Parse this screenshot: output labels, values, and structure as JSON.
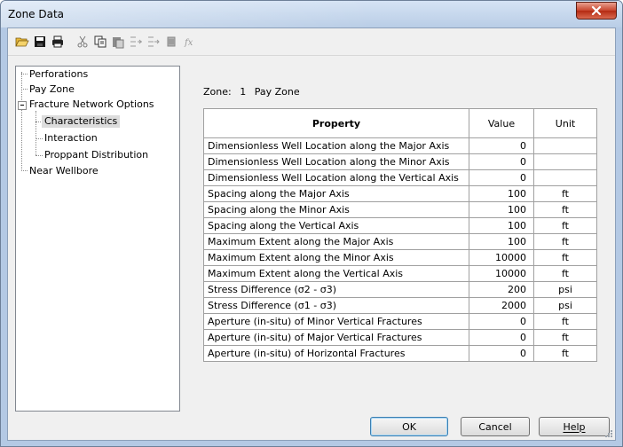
{
  "window": {
    "title": "Zone Data",
    "close_icon": "close-icon"
  },
  "toolbar": {
    "icons": [
      "open-icon",
      "save-icon",
      "print-icon",
      "cut-icon",
      "copy-icon",
      "paste-icon",
      "insert-row-icon",
      "append-row-icon",
      "delete-row-icon",
      "function-icon"
    ]
  },
  "tree": {
    "items": [
      {
        "label": "Perforations"
      },
      {
        "label": "Pay Zone"
      },
      {
        "label": "Fracture Network Options"
      },
      {
        "label": "Characteristics"
      },
      {
        "label": "Interaction"
      },
      {
        "label": "Proppant Distribution"
      },
      {
        "label": "Near Wellbore"
      }
    ],
    "selected": "Characteristics"
  },
  "zone": {
    "label": "Zone:",
    "number": "1",
    "name": "Pay Zone"
  },
  "table": {
    "headers": {
      "property": "Property",
      "value": "Value",
      "unit": "Unit"
    },
    "rows": [
      {
        "property": "Dimensionless Well Location along the Major Axis",
        "value": "0",
        "unit": ""
      },
      {
        "property": "Dimensionless Well Location along the Minor Axis",
        "value": "0",
        "unit": ""
      },
      {
        "property": "Dimensionless Well Location along the Vertical Axis",
        "value": "0",
        "unit": ""
      },
      {
        "property": "Spacing along the Major Axis",
        "value": "100",
        "unit": "ft"
      },
      {
        "property": "Spacing along the Minor Axis",
        "value": "100",
        "unit": "ft"
      },
      {
        "property": "Spacing along the Vertical Axis",
        "value": "100",
        "unit": "ft"
      },
      {
        "property": "Maximum Extent along the Major Axis",
        "value": "100",
        "unit": "ft"
      },
      {
        "property": "Maximum Extent along the Minor Axis",
        "value": "10000",
        "unit": "ft"
      },
      {
        "property": "Maximum Extent along the Vertical Axis",
        "value": "10000",
        "unit": "ft"
      },
      {
        "property": "Stress Difference (σ2 - σ3)",
        "value": "200",
        "unit": "psi"
      },
      {
        "property": "Stress Difference (σ1 - σ3)",
        "value": "2000",
        "unit": "psi"
      },
      {
        "property": "Aperture (in-situ) of Minor Vertical Fractures",
        "value": "0",
        "unit": "ft"
      },
      {
        "property": "Aperture (in-situ) of Major Vertical Fractures",
        "value": "0",
        "unit": "ft"
      },
      {
        "property": "Aperture (in-situ) of Horizontal Fractures",
        "value": "0",
        "unit": "ft"
      }
    ]
  },
  "buttons": {
    "ok": "OK",
    "cancel": "Cancel",
    "help": "Help"
  },
  "colors": {
    "close": "#c8452d",
    "titlebar": "#c6d7ec",
    "client": "#f0f0f0",
    "selection": "#dcdcdc"
  }
}
